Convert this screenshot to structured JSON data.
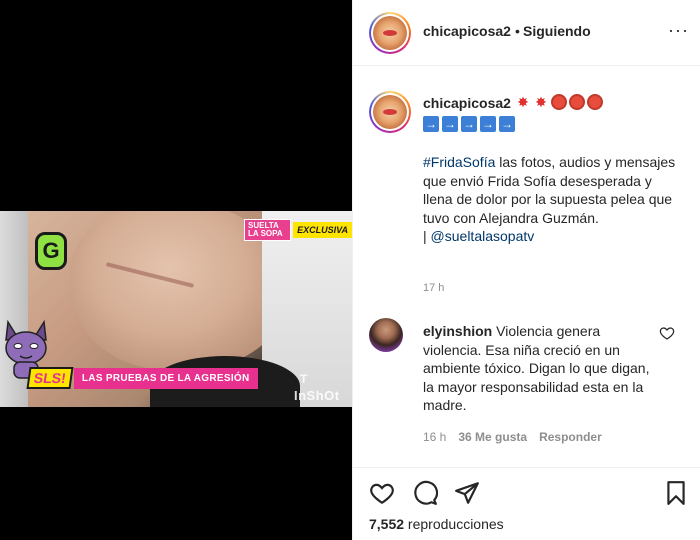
{
  "post": {
    "username": "chicapicosa2",
    "follow_status": "Siguiendo",
    "more": "···"
  },
  "video": {
    "top_badge_small": "SUELTA LA SOPA",
    "top_badge": "EXCLUSIVA",
    "logo_letter": "G",
    "lower_third_brand": "SLS!",
    "lower_third_headline": "LAS PRUEBAS DE LA AGRESIÓN",
    "channel_mark": "T",
    "watermark": "InShOt"
  },
  "caption": {
    "username": "chicapicosa2",
    "emoji_line": [
      "boom",
      "boom",
      "red-circle",
      "red-circle",
      "red-circle"
    ],
    "arrow_line": [
      "→",
      "→",
      "→",
      "→",
      "→"
    ],
    "hashtag": "#FridaSofía",
    "text": " las fotos, audios y mensajes que envió Frida Sofía desesperada y llena de dolor por la supuesta pelea que tuvo con Alejandra Guzmán.",
    "separator": "| ",
    "mention": "@sueltalasopatv",
    "time": "17 h"
  },
  "comment": {
    "username": "elyinshion",
    "text": " Violencia genera violencia. Esa niña creció en un ambiente tóxico. Digan lo que digan, la mayor responsabilidad esta en la madre.",
    "time": "16 h",
    "likes": "36 Me gusta",
    "reply": "Responder"
  },
  "footer": {
    "views_count": "7,552",
    "views_label": " reproducciones"
  },
  "icons": {
    "like": "heart-icon",
    "comment": "comment-icon",
    "share": "share-icon",
    "save": "bookmark-icon"
  }
}
